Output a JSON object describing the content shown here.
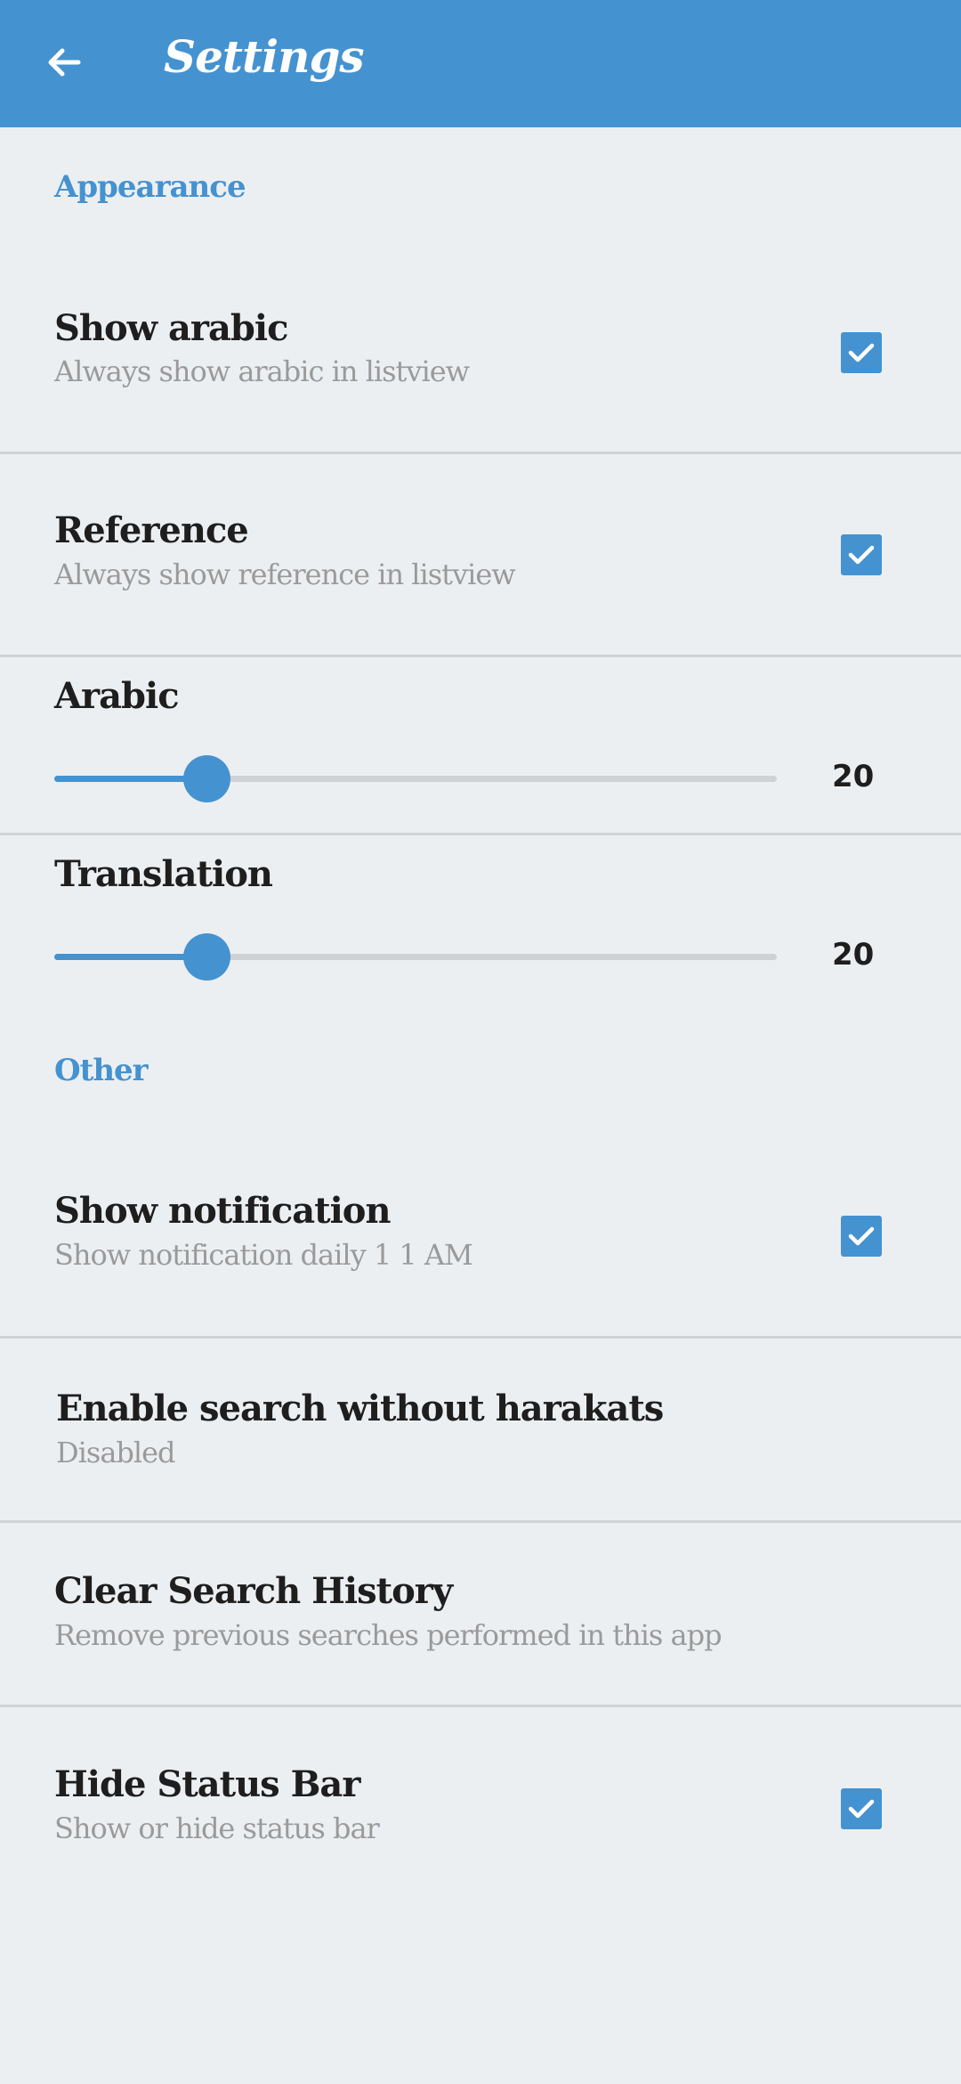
{
  "appbar": {
    "title": "Settings",
    "back_icon": "arrow-left-icon"
  },
  "colors": {
    "accent": "#4592d0",
    "background": "#eceff2",
    "divider": "#d0d3d6",
    "subtitle": "#9a9a9a"
  },
  "appearance": {
    "header": "Appearance",
    "show_arabic": {
      "title": "Show arabic",
      "subtitle": "Always show arabic in listview",
      "checked": true
    },
    "reference": {
      "title": "Reference",
      "subtitle": "Always show reference in listview",
      "checked": true
    },
    "arabic_slider": {
      "label": "Arabic",
      "value": "20",
      "fraction": 0.21
    },
    "translation_slider": {
      "label": "Translation",
      "value": "20",
      "fraction": 0.21
    }
  },
  "other": {
    "header": "Other",
    "show_notification": {
      "title": "Show notification",
      "subtitle": "Show notification daily 1 1 AM",
      "checked": true
    },
    "search_harakats": {
      "title": "Enable search without harakats",
      "subtitle": "Disabled"
    },
    "clear_history": {
      "title": "Clear Search History",
      "subtitle": "Remove previous searches performed in this app"
    },
    "hide_status_bar": {
      "title": "Hide Status Bar",
      "subtitle": "Show or hide status bar",
      "checked": true
    }
  }
}
